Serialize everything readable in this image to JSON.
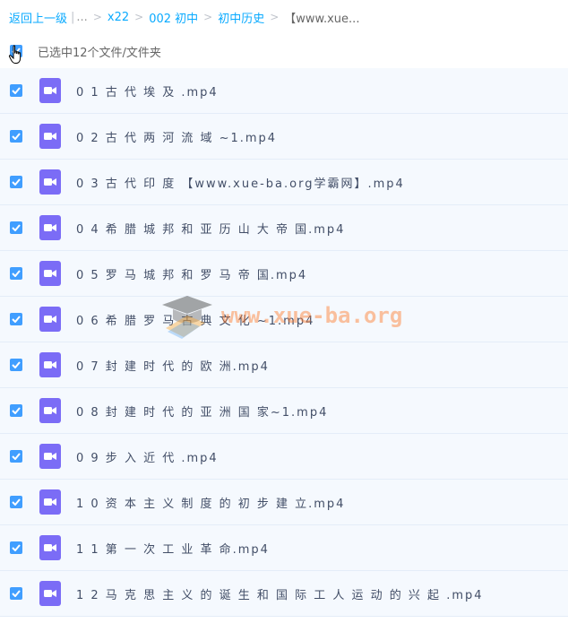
{
  "breadcrumb": {
    "back": "返回上一级",
    "pipe": "|",
    "ellipsis": "...",
    "sep": ">",
    "items": [
      "x22",
      "002 初中",
      "初中历史"
    ],
    "current": "【www.xue..."
  },
  "selection": {
    "label": "已选中12个文件/文件夹"
  },
  "files": [
    "0 1 古 代 埃 及 .mp4",
    "0 2 古 代 两 河 流 域 ~1.mp4",
    "0 3 古 代 印 度 【www.xue-ba.org学霸网】.mp4",
    "0 4 希 腊 城 邦 和 亚 历 山 大 帝 国.mp4",
    "0 5 罗 马 城 邦 和 罗 马 帝 国.mp4",
    "0 6 希 腊 罗 马 古 典 文 化 ~1.mp4",
    "0 7 封 建 时 代 的 欧 洲.mp4",
    "0 8 封 建 时 代 的 亚 洲 国 家~1.mp4",
    "0 9 步 入 近 代 .mp4",
    "1 0 资 本 主 义 制 度 的 初 步 建 立.mp4",
    "1 1 第 一 次 工 业 革 命.mp4",
    "1 2 马 克 思 主 义 的 诞 生 和 国 际 工 人 运 动 的 兴 起 .mp4"
  ],
  "watermark": {
    "text": "www.xue-ba.org"
  },
  "colors": {
    "link": "#09aaff",
    "checkbox": "#409eff",
    "video_icon": "#7b6cf6",
    "row_bg": "#f5f9fe"
  },
  "icons": {
    "file": "video-file-icon",
    "check": "checkmark-icon",
    "cursor": "hand-pointer-icon",
    "logo": "graduation-cap-icon"
  }
}
